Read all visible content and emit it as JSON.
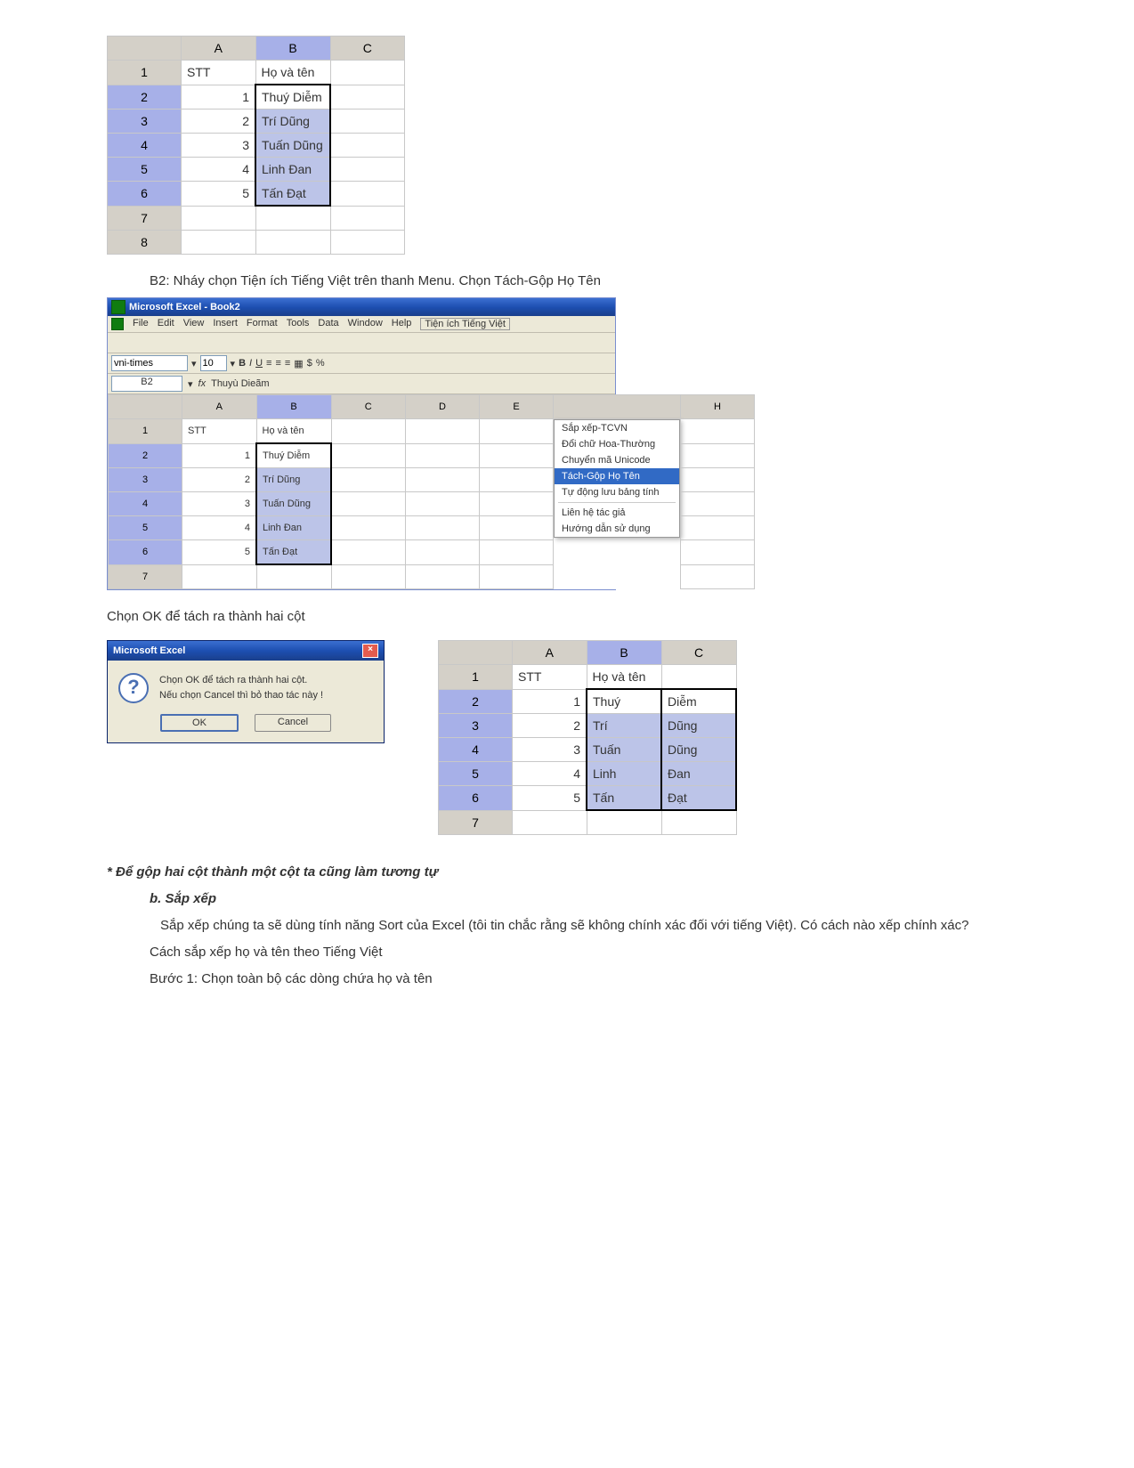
{
  "grid1": {
    "cols": [
      "A",
      "B",
      "C"
    ],
    "rows": [
      {
        "n": "1",
        "a": "STT",
        "b": "Họ và tên",
        "c": ""
      },
      {
        "n": "2",
        "a": "1",
        "b": "Thuý Diễm",
        "c": ""
      },
      {
        "n": "3",
        "a": "2",
        "b": "Trí Dũng",
        "c": ""
      },
      {
        "n": "4",
        "a": "3",
        "b": "Tuấn Dũng",
        "c": ""
      },
      {
        "n": "5",
        "a": "4",
        "b": "Linh Đan",
        "c": ""
      },
      {
        "n": "6",
        "a": "5",
        "b": "Tấn Đạt",
        "c": ""
      },
      {
        "n": "7",
        "a": "",
        "b": "",
        "c": ""
      },
      {
        "n": "8",
        "a": "",
        "b": "",
        "c": ""
      }
    ]
  },
  "step_b2": "B2: Nháy chọn Tiện ích Tiếng Việt trên thanh Menu. Chọn Tách-Gộp Họ Tên",
  "win2": {
    "title": "Microsoft Excel - Book2",
    "menus": [
      "File",
      "Edit",
      "View",
      "Insert",
      "Format",
      "Tools",
      "Data",
      "Window",
      "Help",
      "Tiện ích Tiếng Việt"
    ],
    "font": "vni-times",
    "fsize": "10",
    "cellref": "B2",
    "fxval": "Thuyù Dieãm",
    "dropdown": [
      "Sắp xếp-TCVN",
      "Đổi chữ Hoa-Thường",
      "Chuyển mã Unicode",
      "Tách-Gộp Họ Tên",
      "Tự động lưu bảng tính",
      "Liên hệ tác giả",
      "Hướng dẫn sử dụng"
    ],
    "sheet_cols": [
      "A",
      "B",
      "C",
      "D",
      "E",
      "",
      "",
      "H"
    ],
    "sheet": [
      {
        "n": "1",
        "a": "STT",
        "b": "Họ và tên"
      },
      {
        "n": "2",
        "a": "1",
        "b": "Thuý Diễm"
      },
      {
        "n": "3",
        "a": "2",
        "b": "Trí Dũng"
      },
      {
        "n": "4",
        "a": "3",
        "b": "Tuấn Dũng"
      },
      {
        "n": "5",
        "a": "4",
        "b": "Linh Đan"
      },
      {
        "n": "6",
        "a": "5",
        "b": "Tấn Đạt"
      },
      {
        "n": "7",
        "a": "",
        "b": ""
      }
    ]
  },
  "ok_caption": "Chọn OK để tách ra thành hai cột",
  "dlg": {
    "title": "Microsoft Excel",
    "line1": "Chọn OK để tách ra thành hai cột.",
    "line2": "Nếu chọn Cancel thì bỏ thao tác này !",
    "ok": "OK",
    "cancel": "Cancel"
  },
  "grid3": {
    "cols": [
      "A",
      "B",
      "C"
    ],
    "rows": [
      {
        "n": "1",
        "a": "STT",
        "b": "Họ và tên",
        "c": ""
      },
      {
        "n": "2",
        "a": "1",
        "b": "Thuý",
        "c": "Diễm"
      },
      {
        "n": "3",
        "a": "2",
        "b": "Trí",
        "c": "Dũng"
      },
      {
        "n": "4",
        "a": "3",
        "b": "Tuấn",
        "c": "Dũng"
      },
      {
        "n": "5",
        "a": "4",
        "b": "Linh",
        "c": "Đan"
      },
      {
        "n": "6",
        "a": "5",
        "b": "Tấn",
        "c": "Đạt"
      },
      {
        "n": "7",
        "a": "",
        "b": "",
        "c": ""
      }
    ]
  },
  "note1": "* Để gộp hai cột thành một cột ta cũng làm tương tự",
  "heading_b": "b. Sắp xếp",
  "para_sort": "Sắp xếp chúng ta sẽ dùng tính năng Sort của Excel (tôi tin chắc rằng sẽ không chính xác đối với tiếng Việt). Có cách nào xếp chính xác?",
  "para_method": "Cách sắp xếp họ và tên theo Tiếng Việt",
  "para_step1": "Bước 1: Chọn toàn bộ các dòng chứa họ và tên"
}
